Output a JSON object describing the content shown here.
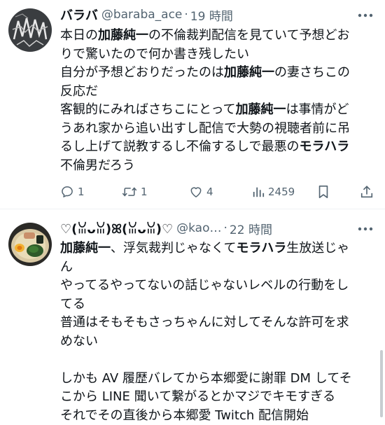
{
  "tweets": [
    {
      "display_name": "バラバ",
      "handle": "@baraba_ace",
      "separator": "·",
      "time": "19 時間",
      "avatar_icon": "scribble-avatar-icon",
      "lines": [
        [
          "本日の",
          {
            "bold": "加藤純一"
          },
          "の不倫裁判配信を見ていて予想どお"
        ],
        [
          "りで驚いたので何か書き残したい"
        ],
        [
          "自分が予想どおりだったのは",
          {
            "bold": "加藤純一"
          },
          "の妻さちこの"
        ],
        [
          "反応だ"
        ],
        [
          "客観的にみればさちこにとって",
          {
            "bold": "加藤純一"
          },
          "は事情がど"
        ],
        [
          "うあれ家から追い出すし配信で大勢の視聴者前に吊"
        ],
        [
          "るし上げて説教するし不倫するしで最悪の",
          {
            "bold": "モラハラ"
          }
        ],
        [
          "不倫男だろう"
        ]
      ],
      "actions": {
        "reply_count": "1",
        "retweet_count": "1",
        "like_count": "4",
        "views_count": "2459"
      }
    },
    {
      "display_name": "♡(ꈍᴗꈍ)ꕤ(ꈍᴗꈍ)♡",
      "handle": "@kao…",
      "separator": "·",
      "time": "22 時間",
      "avatar_icon": "ramen-bowl-avatar-icon",
      "lines": [
        [
          {
            "bold": "加藤純一"
          },
          "、浮気裁判じゃなくて",
          {
            "bold": "モラハラ"
          },
          "生放送じゃ"
        ],
        [
          "ん"
        ],
        [
          "やってるやってないの話じゃないレベルの行動をし"
        ],
        [
          "てる"
        ],
        [
          "普通はそもそもさっちゃんに対してそんな許可を求"
        ],
        [
          "めない"
        ],
        [],
        [
          "しかも AV 履歴バレてから本郷愛に謝罪 DM してそ"
        ],
        [
          "こから LINE 聞いて繋がるとかマジでキモすぎる"
        ],
        [
          "それでその直後から本郷愛 Twitch 配信開始"
        ]
      ]
    }
  ],
  "colors": {
    "text": "#0f1419",
    "secondary": "#536471",
    "divider": "#eff3f4"
  },
  "icons": {
    "more": "more-dots-icon",
    "reply": "reply-icon",
    "retweet": "retweet-icon",
    "like": "heart-icon",
    "views": "views-chart-icon",
    "bookmark": "bookmark-icon",
    "share": "share-icon"
  }
}
